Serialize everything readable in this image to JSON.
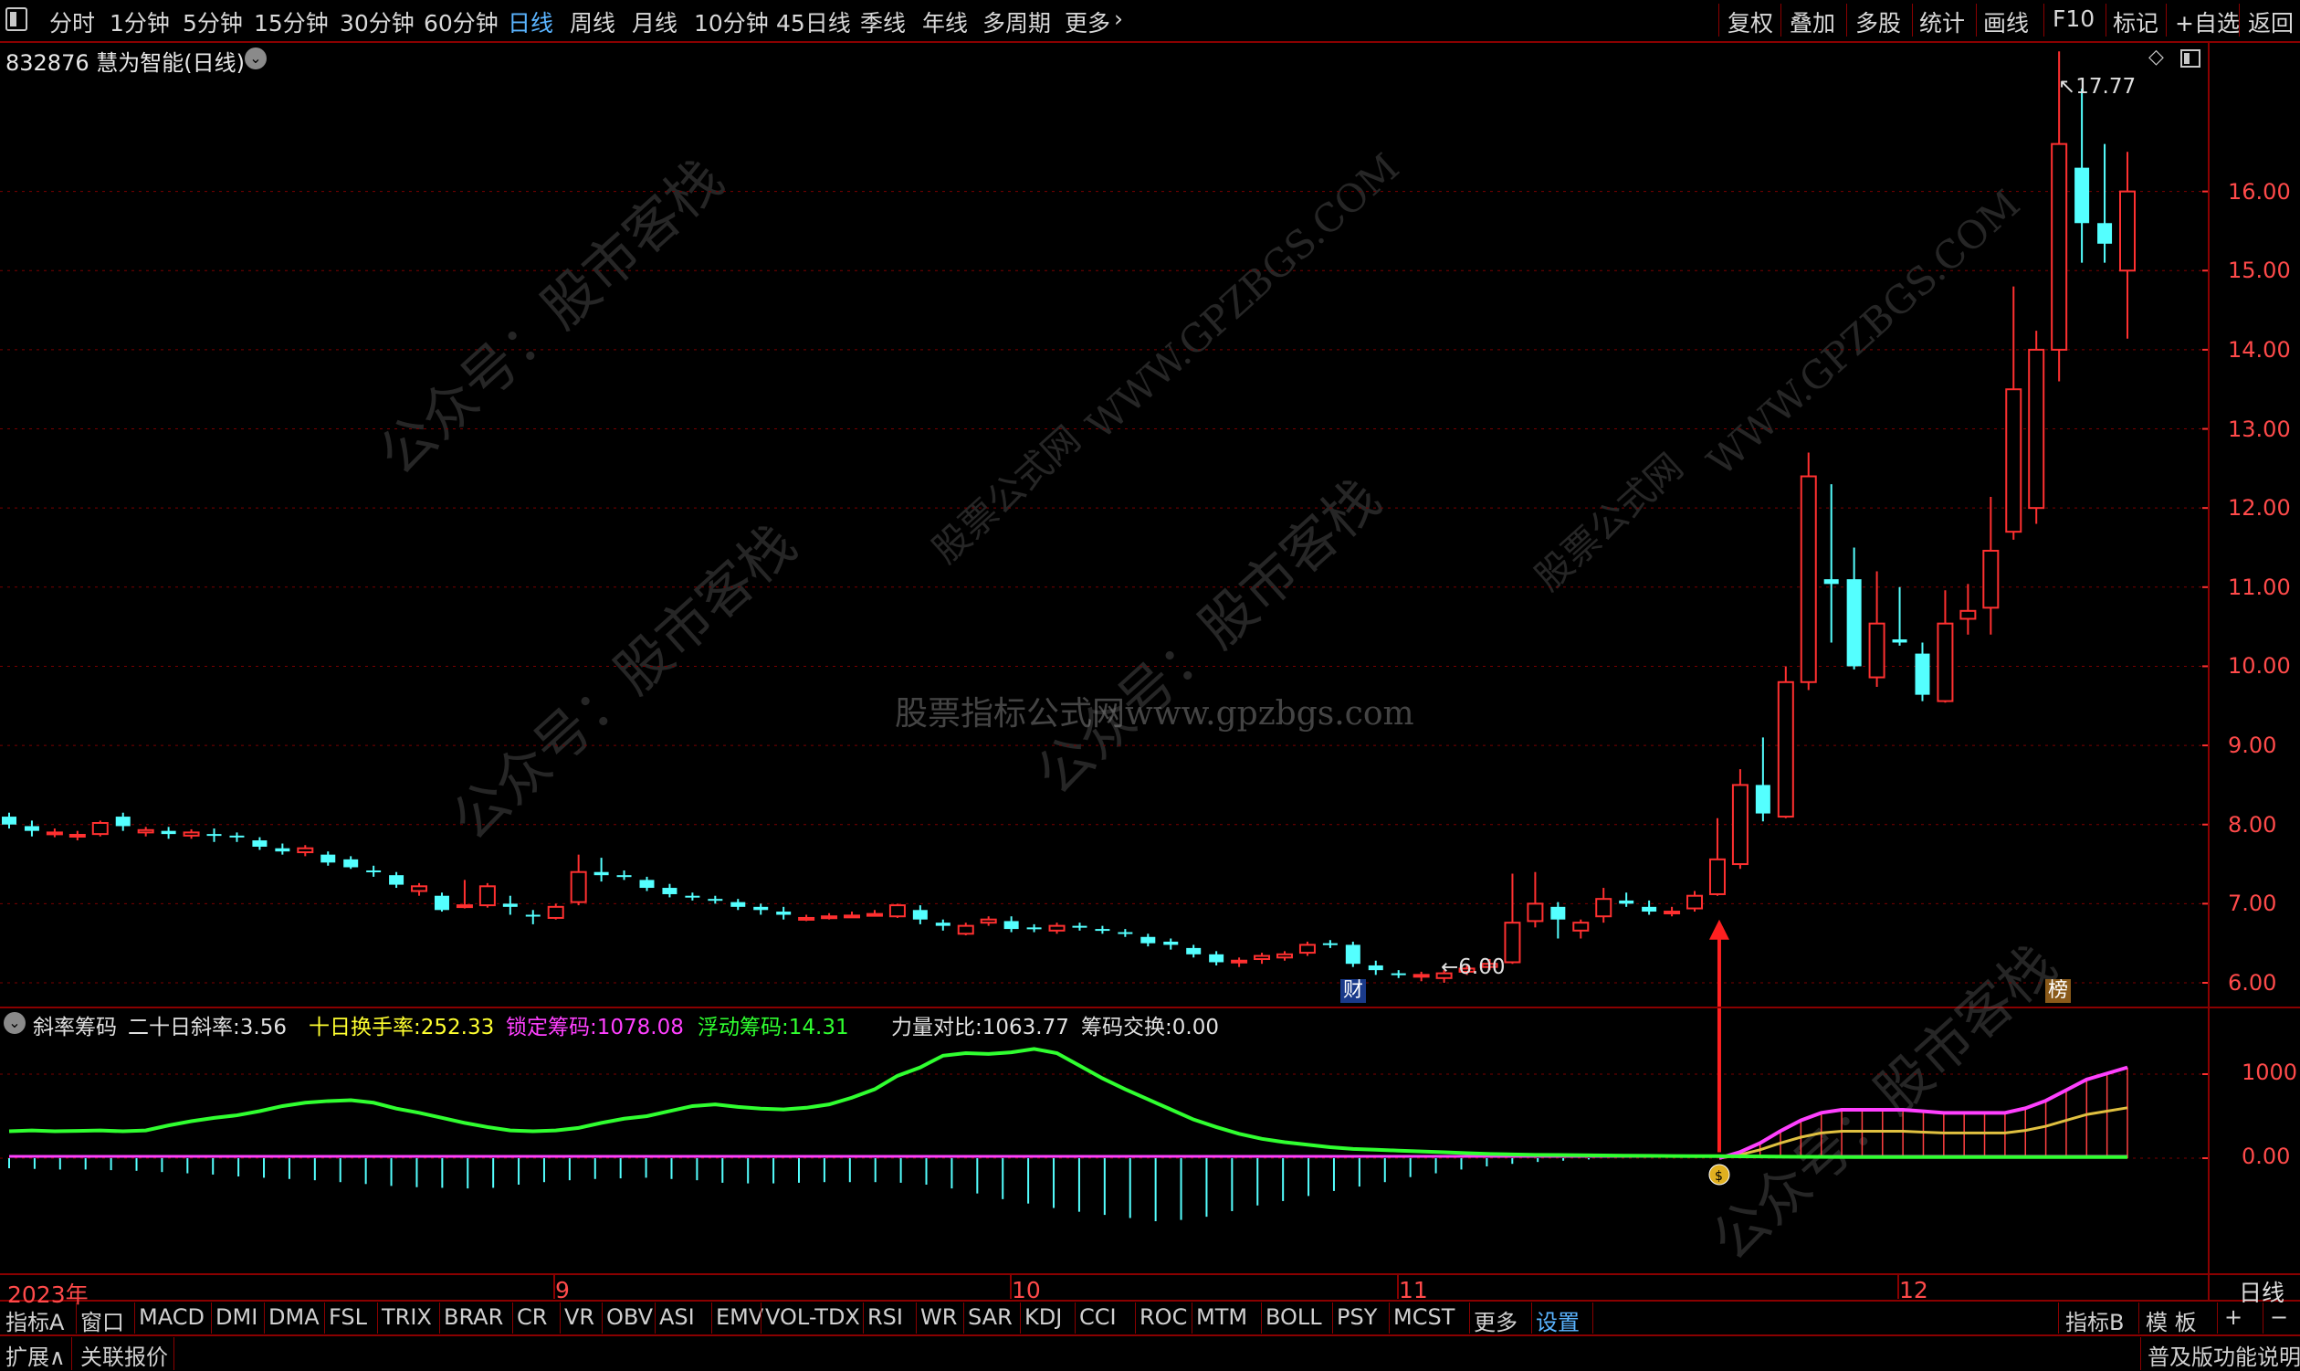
{
  "toolbar": {
    "periods": [
      "分时",
      "1分钟",
      "5分钟",
      "15分钟",
      "30分钟",
      "60分钟",
      "日线",
      "周线",
      "月线",
      "10分钟",
      "45日线",
      "季线",
      "年线",
      "多周期",
      "更多"
    ],
    "active_period": "日线",
    "right_buttons": [
      "复权",
      "叠加",
      "多股",
      "统计",
      "画线",
      "F10",
      "标记",
      "+自选",
      "返回"
    ]
  },
  "stock": {
    "title": "832876 慧为智能(日线)",
    "high_marker": "17.77",
    "low_marker": "6.00",
    "badge_cai": "财",
    "badge_bang": "榜"
  },
  "price_axis": {
    "ticks": [
      "16.00",
      "15.00",
      "14.00",
      "13.00",
      "12.00",
      "11.00",
      "10.00",
      "9.00",
      "8.00",
      "7.00",
      "6.00"
    ]
  },
  "indicator": {
    "name": "斜率筹码",
    "items": [
      {
        "label": "二十日斜率:",
        "value": "3.56",
        "color": "#e0e0e0"
      },
      {
        "label": "十日换手率:",
        "value": "252.33",
        "color": "#ffff30"
      },
      {
        "label": "锁定筹码:",
        "value": "1078.08",
        "color": "#ff40ff"
      },
      {
        "label": "浮动筹码:",
        "value": "14.31",
        "color": "#30ff30"
      },
      {
        "label": "力量对比:",
        "value": "1063.77",
        "color": "#e0e0e0"
      },
      {
        "label": "筹码交换:",
        "value": "0.00",
        "color": "#e0e0e0"
      }
    ],
    "ticks": [
      "1000",
      "0.00"
    ]
  },
  "dates": {
    "year": "2023年",
    "months": [
      "9",
      "10",
      "11",
      "12"
    ],
    "right_label": "日线"
  },
  "indicator_tabs": [
    "指标A",
    "窗口",
    "MACD",
    "DMI",
    "DMA",
    "FSL",
    "TRIX",
    "BRAR",
    "CR",
    "VR",
    "OBV",
    "ASI",
    "EMV",
    "VOL-TDX",
    "RSI",
    "WR",
    "SAR",
    "KDJ",
    "CCI",
    "ROC",
    "MTM",
    "BOLL",
    "PSY",
    "MCST",
    "更多",
    "设置"
  ],
  "indicator_right": [
    "指标B",
    "模 板",
    "+",
    "−"
  ],
  "status": {
    "expand": "扩展∧",
    "related": "关联报价",
    "right": "普及版功能说明"
  },
  "watermarks": [
    "公众号：股市客栈",
    "WWW.GPZBGS.COM",
    "股票公式网",
    "股票指标公式网www.gpzbgs.com"
  ],
  "colors": {
    "up": "#ff3030",
    "down": "#54ffff",
    "grid": "#8a0000",
    "active": "#5ab4ff"
  },
  "chart_data": {
    "type": "candlestick",
    "ylim": [
      5.7,
      17.9
    ],
    "candles": [
      {
        "o": 8.1,
        "c": 8.0,
        "h": 8.15,
        "l": 7.95
      },
      {
        "o": 7.98,
        "c": 7.92,
        "h": 8.05,
        "l": 7.85
      },
      {
        "o": 7.88,
        "c": 7.9,
        "h": 7.95,
        "l": 7.84
      },
      {
        "o": 7.86,
        "c": 7.87,
        "h": 7.92,
        "l": 7.8
      },
      {
        "o": 7.88,
        "c": 8.02,
        "h": 8.05,
        "l": 7.85
      },
      {
        "o": 8.1,
        "c": 7.98,
        "h": 8.15,
        "l": 7.92
      },
      {
        "o": 7.9,
        "c": 7.93,
        "h": 7.97,
        "l": 7.85
      },
      {
        "o": 7.92,
        "c": 7.88,
        "h": 7.97,
        "l": 7.82
      },
      {
        "o": 7.86,
        "c": 7.9,
        "h": 7.94,
        "l": 7.82
      },
      {
        "o": 7.88,
        "c": 7.86,
        "h": 7.95,
        "l": 7.78
      },
      {
        "o": 7.86,
        "c": 7.84,
        "h": 7.9,
        "l": 7.78
      },
      {
        "o": 7.8,
        "c": 7.72,
        "h": 7.84,
        "l": 7.68
      },
      {
        "o": 7.7,
        "c": 7.66,
        "h": 7.76,
        "l": 7.62
      },
      {
        "o": 7.65,
        "c": 7.7,
        "h": 7.74,
        "l": 7.6
      },
      {
        "o": 7.62,
        "c": 7.52,
        "h": 7.66,
        "l": 7.48
      },
      {
        "o": 7.56,
        "c": 7.46,
        "h": 7.6,
        "l": 7.44
      },
      {
        "o": 7.42,
        "c": 7.4,
        "h": 7.48,
        "l": 7.34
      },
      {
        "o": 7.36,
        "c": 7.24,
        "h": 7.4,
        "l": 7.2
      },
      {
        "o": 7.16,
        "c": 7.22,
        "h": 7.26,
        "l": 7.1
      },
      {
        "o": 7.1,
        "c": 6.92,
        "h": 7.14,
        "l": 6.9
      },
      {
        "o": 6.96,
        "c": 6.98,
        "h": 7.3,
        "l": 6.94
      },
      {
        "o": 6.98,
        "c": 7.22,
        "h": 7.26,
        "l": 6.95
      },
      {
        "o": 7.0,
        "c": 6.96,
        "h": 7.1,
        "l": 6.86
      },
      {
        "o": 6.86,
        "c": 6.84,
        "h": 6.92,
        "l": 6.74
      },
      {
        "o": 6.82,
        "c": 6.96,
        "h": 7.0,
        "l": 6.8
      },
      {
        "o": 7.02,
        "c": 7.4,
        "h": 7.62,
        "l": 6.98
      },
      {
        "o": 7.4,
        "c": 7.36,
        "h": 7.58,
        "l": 7.28
      },
      {
        "o": 7.36,
        "c": 7.34,
        "h": 7.42,
        "l": 7.3
      },
      {
        "o": 7.3,
        "c": 7.2,
        "h": 7.34,
        "l": 7.16
      },
      {
        "o": 7.2,
        "c": 7.12,
        "h": 7.25,
        "l": 7.08
      },
      {
        "o": 7.1,
        "c": 7.08,
        "h": 7.14,
        "l": 7.04
      },
      {
        "o": 7.06,
        "c": 7.04,
        "h": 7.1,
        "l": 7.0
      },
      {
        "o": 7.02,
        "c": 6.96,
        "h": 7.06,
        "l": 6.92
      },
      {
        "o": 6.96,
        "c": 6.92,
        "h": 7.0,
        "l": 6.86
      },
      {
        "o": 6.9,
        "c": 6.86,
        "h": 6.96,
        "l": 6.8
      },
      {
        "o": 6.8,
        "c": 6.82,
        "h": 6.86,
        "l": 6.78
      },
      {
        "o": 6.82,
        "c": 6.84,
        "h": 6.88,
        "l": 6.8
      },
      {
        "o": 6.84,
        "c": 6.85,
        "h": 6.9,
        "l": 6.82
      },
      {
        "o": 6.86,
        "c": 6.87,
        "h": 6.92,
        "l": 6.84
      },
      {
        "o": 6.84,
        "c": 6.98,
        "h": 7.0,
        "l": 6.82
      },
      {
        "o": 6.92,
        "c": 6.8,
        "h": 6.98,
        "l": 6.74
      },
      {
        "o": 6.76,
        "c": 6.72,
        "h": 6.8,
        "l": 6.66
      },
      {
        "o": 6.62,
        "c": 6.72,
        "h": 6.76,
        "l": 6.6
      },
      {
        "o": 6.76,
        "c": 6.8,
        "h": 6.84,
        "l": 6.72
      },
      {
        "o": 6.78,
        "c": 6.68,
        "h": 6.84,
        "l": 6.64
      },
      {
        "o": 6.7,
        "c": 6.68,
        "h": 6.74,
        "l": 6.64
      },
      {
        "o": 6.66,
        "c": 6.72,
        "h": 6.76,
        "l": 6.62
      },
      {
        "o": 6.72,
        "c": 6.7,
        "h": 6.76,
        "l": 6.66
      },
      {
        "o": 6.68,
        "c": 6.66,
        "h": 6.72,
        "l": 6.62
      },
      {
        "o": 6.64,
        "c": 6.62,
        "h": 6.68,
        "l": 6.58
      },
      {
        "o": 6.58,
        "c": 6.5,
        "h": 6.62,
        "l": 6.46
      },
      {
        "o": 6.52,
        "c": 6.48,
        "h": 6.56,
        "l": 6.42
      },
      {
        "o": 6.44,
        "c": 6.36,
        "h": 6.48,
        "l": 6.32
      },
      {
        "o": 6.36,
        "c": 6.26,
        "h": 6.4,
        "l": 6.22
      },
      {
        "o": 6.26,
        "c": 6.28,
        "h": 6.32,
        "l": 6.2
      },
      {
        "o": 6.3,
        "c": 6.34,
        "h": 6.38,
        "l": 6.24
      },
      {
        "o": 6.32,
        "c": 6.36,
        "h": 6.4,
        "l": 6.28
      },
      {
        "o": 6.38,
        "c": 6.48,
        "h": 6.52,
        "l": 6.34
      },
      {
        "o": 6.5,
        "c": 6.48,
        "h": 6.54,
        "l": 6.44
      },
      {
        "o": 6.48,
        "c": 6.24,
        "h": 6.52,
        "l": 6.2
      },
      {
        "o": 6.22,
        "c": 6.16,
        "h": 6.28,
        "l": 6.1
      },
      {
        "o": 6.12,
        "c": 6.1,
        "h": 6.16,
        "l": 6.06
      },
      {
        "o": 6.08,
        "c": 6.1,
        "h": 6.14,
        "l": 6.02
      },
      {
        "o": 6.06,
        "c": 6.12,
        "h": 6.16,
        "l": 6.0
      },
      {
        "o": 6.14,
        "c": 6.18,
        "h": 6.22,
        "l": 6.1
      },
      {
        "o": 6.2,
        "c": 6.24,
        "h": 6.3,
        "l": 6.16
      },
      {
        "o": 6.26,
        "c": 6.76,
        "h": 7.38,
        "l": 6.24
      },
      {
        "o": 6.78,
        "c": 7.0,
        "h": 7.4,
        "l": 6.7
      },
      {
        "o": 6.96,
        "c": 6.8,
        "h": 7.02,
        "l": 6.56
      },
      {
        "o": 6.66,
        "c": 6.76,
        "h": 6.8,
        "l": 6.56
      },
      {
        "o": 6.84,
        "c": 7.06,
        "h": 7.2,
        "l": 6.76
      },
      {
        "o": 7.04,
        "c": 7.0,
        "h": 7.14,
        "l": 6.96
      },
      {
        "o": 6.96,
        "c": 6.9,
        "h": 7.04,
        "l": 6.86
      },
      {
        "o": 6.88,
        "c": 6.9,
        "h": 6.96,
        "l": 6.84
      },
      {
        "o": 6.94,
        "c": 7.1,
        "h": 7.16,
        "l": 6.9
      },
      {
        "o": 7.12,
        "c": 7.56,
        "h": 8.08,
        "l": 7.1
      },
      {
        "o": 7.5,
        "c": 8.5,
        "h": 8.7,
        "l": 7.44
      },
      {
        "o": 8.5,
        "c": 8.14,
        "h": 9.1,
        "l": 8.04
      },
      {
        "o": 8.1,
        "c": 9.8,
        "h": 10.0,
        "l": 8.08
      },
      {
        "o": 9.8,
        "c": 12.4,
        "h": 12.7,
        "l": 9.7
      },
      {
        "o": 11.1,
        "c": 11.04,
        "h": 12.3,
        "l": 10.3
      },
      {
        "o": 11.1,
        "c": 10.0,
        "h": 11.5,
        "l": 9.96
      },
      {
        "o": 9.86,
        "c": 10.54,
        "h": 11.2,
        "l": 9.74
      },
      {
        "o": 10.34,
        "c": 10.3,
        "h": 11.0,
        "l": 10.26
      },
      {
        "o": 10.16,
        "c": 9.64,
        "h": 10.3,
        "l": 9.56
      },
      {
        "o": 9.56,
        "c": 10.54,
        "h": 10.96,
        "l": 9.54
      },
      {
        "o": 10.6,
        "c": 10.7,
        "h": 11.04,
        "l": 10.4
      },
      {
        "o": 10.74,
        "c": 11.46,
        "h": 12.14,
        "l": 10.4
      },
      {
        "o": 11.7,
        "c": 13.5,
        "h": 14.8,
        "l": 11.6
      },
      {
        "o": 12.0,
        "c": 14.0,
        "h": 14.24,
        "l": 11.8
      },
      {
        "o": 14.0,
        "c": 16.6,
        "h": 17.77,
        "l": 13.6
      },
      {
        "o": 16.3,
        "c": 15.6,
        "h": 17.3,
        "l": 15.1
      },
      {
        "o": 15.6,
        "c": 15.34,
        "h": 16.6,
        "l": 15.1
      },
      {
        "o": 15.0,
        "c": 16.0,
        "h": 16.5,
        "l": 14.14
      }
    ]
  }
}
